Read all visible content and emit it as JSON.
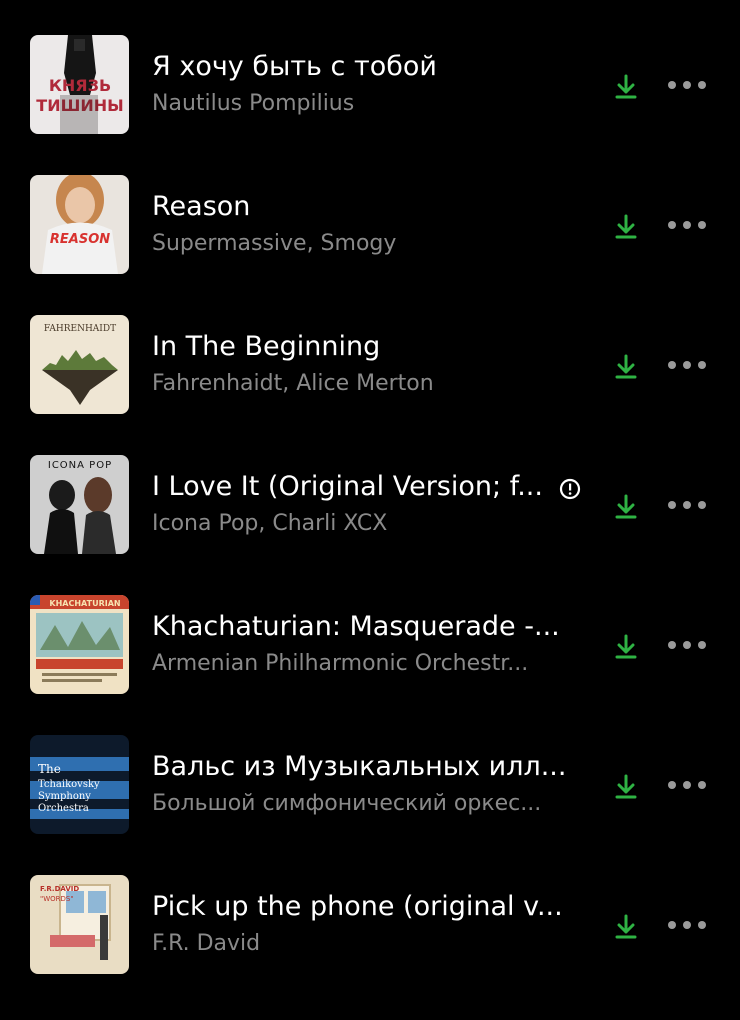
{
  "tracks": [
    {
      "title": "Я хочу быть с тобой",
      "artist": "Nautilus Pompilius",
      "cover_text": "КНЯЗЬ ТИШИНЫ",
      "explicit": false
    },
    {
      "title": "Reason",
      "artist": "Supermassive, Smogy",
      "cover_text": "REASON",
      "explicit": false
    },
    {
      "title": "In The Beginning",
      "artist": "Fahrenhaidt, Alice Merton",
      "cover_text": "FAHRENHAIDT",
      "explicit": false
    },
    {
      "title": "I Love It (Original Version; f...",
      "artist": "Icona Pop, Charli XCX",
      "cover_text": "ICONA POP",
      "explicit": true
    },
    {
      "title": "Khachaturian: Masquerade -...",
      "artist": "Armenian Philharmonic Orchestr...",
      "cover_text": "KHACHATURIAN",
      "explicit": false
    },
    {
      "title": "Вальс из Музыкальных илл...",
      "artist": "Большой симфонический оркес...",
      "cover_text": "The Tchaikovsky Symphony Orchestra",
      "explicit": false
    },
    {
      "title": "Pick up the phone (original v...",
      "artist": "F.R. David",
      "cover_text": "F.R. DAVID \"WORDS\"",
      "explicit": false
    }
  ],
  "icons": {
    "download": "download-icon",
    "more": "more-options-icon",
    "explicit": "explicit-warning-icon"
  },
  "colors": {
    "background": "#000000",
    "title": "#ffffff",
    "artist": "#8a8a8a",
    "download": "#2fb344",
    "more": "#9a9a9a"
  }
}
